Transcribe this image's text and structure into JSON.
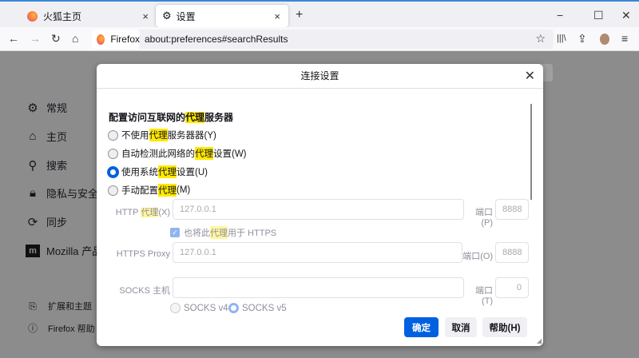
{
  "tabs": [
    {
      "label": "火狐主页"
    },
    {
      "label": "设置"
    }
  ],
  "tab_close": "×",
  "new_tab": "+",
  "window": {
    "minimize": "−",
    "maximize": "☐",
    "close": "✕"
  },
  "nav": {
    "back": "←",
    "forward": "→",
    "reload": "↻",
    "home": "⌂",
    "identity": "Firefox",
    "url": "about:preferences#searchResults",
    "bookmark": "☆",
    "library": "|||\\",
    "extensions": "⇪",
    "menu": "≡"
  },
  "sidebar": {
    "items": [
      {
        "label": "常规"
      },
      {
        "label": "主页"
      },
      {
        "label": "搜索"
      },
      {
        "label": "隐私与安全"
      },
      {
        "label": "同步"
      },
      {
        "label": "Mozilla 产品"
      }
    ],
    "footer": [
      {
        "label": "扩展和主题"
      },
      {
        "label": "Firefox 帮助"
      }
    ]
  },
  "dialog": {
    "title": "连接设置",
    "close": "✕",
    "heading_pre": "配置访问互联网的",
    "hl": "代理",
    "heading_post": "服务器",
    "options": [
      {
        "pre": "不使用",
        "post": "服务器器(Y)"
      },
      {
        "pre": "自动检测此网络的",
        "post": "设置(W)"
      },
      {
        "pre": "使用系统",
        "post": "设置(U)"
      },
      {
        "pre": "手动配置",
        "post": "(M)"
      }
    ],
    "http_label_pre": "HTTP ",
    "http_label_post": "(X)",
    "http_value": "127.0.0.1",
    "http_port_label": "端口(P)",
    "http_port": "8888",
    "also_https_pre": "也将此",
    "also_https_post": "用于 HTTPS",
    "https_label": "HTTPS Proxy",
    "https_value": "127.0.0.1",
    "https_port_label": "端口(O)",
    "https_port": "8888",
    "socks_label": "SOCKS 主机",
    "socks_value": "",
    "socks_port_label": "端口(T)",
    "socks_port": "0",
    "socks_v4": "SOCKS v4",
    "socks_v5": "SOCKS v5",
    "ok": "确定",
    "cancel": "取消",
    "help": "帮助(H)"
  }
}
